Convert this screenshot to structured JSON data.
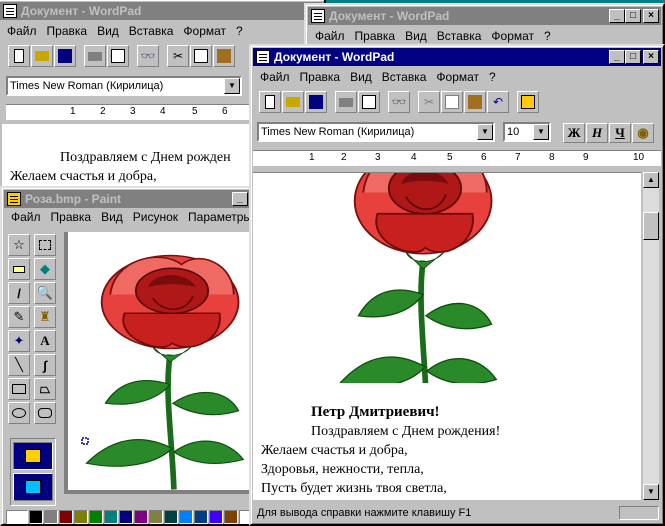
{
  "wordpad_back": {
    "title": "Документ - WordPad",
    "menu": [
      "Файл",
      "Правка",
      "Вид",
      "Вставка",
      "Формат",
      "?"
    ],
    "font": "Times New Roman (Кирилица)",
    "ruler_labels": [
      "1",
      "2",
      "3",
      "4",
      "5",
      "6"
    ],
    "lines": [
      "Поздравляем с Днем рожден",
      "Желаем счастья и добра,"
    ]
  },
  "wordpad_middle": {
    "title": "Документ - WordPad",
    "menu": [
      "Файл",
      "Правка",
      "Вид",
      "Вставка",
      "Формат",
      "?"
    ]
  },
  "paint": {
    "title": "Роза.bmp - Paint",
    "menu": [
      "Файл",
      "Правка",
      "Вид",
      "Рисунок",
      "Параметры"
    ],
    "palette": [
      "#000000",
      "#808080",
      "#800000",
      "#808000",
      "#008000",
      "#008080",
      "#000080",
      "#800080",
      "#808040",
      "#004040",
      "#0080ff",
      "#004080",
      "#4000ff",
      "#804000",
      "#ffffff"
    ]
  },
  "wordpad_front": {
    "title": "Документ - WordPad",
    "menu": [
      "Файл",
      "Правка",
      "Вид",
      "Вставка",
      "Формат",
      "?"
    ],
    "font": "Times New Roman (Кирилица)",
    "size": "10",
    "bold": "Ж",
    "italic": "Н",
    "underline": "Ч",
    "ruler_labels": [
      "1",
      "2",
      "3",
      "4",
      "5",
      "6",
      "7",
      "8",
      "9",
      "10"
    ],
    "name_line": "Петр Дмитриевич!",
    "greeting": "Поздравляем с Днем рождения!",
    "poem": [
      "Желаем счастья и добра,",
      "Здоровья, нежности, тепла,",
      "Пусть будет жизнь твоя светла,"
    ],
    "status": "Для вывода справки нажмите клавишу F1"
  },
  "colors": {
    "active_title": "#000080",
    "inactive_title": "#808080",
    "desktop": "#008080"
  }
}
